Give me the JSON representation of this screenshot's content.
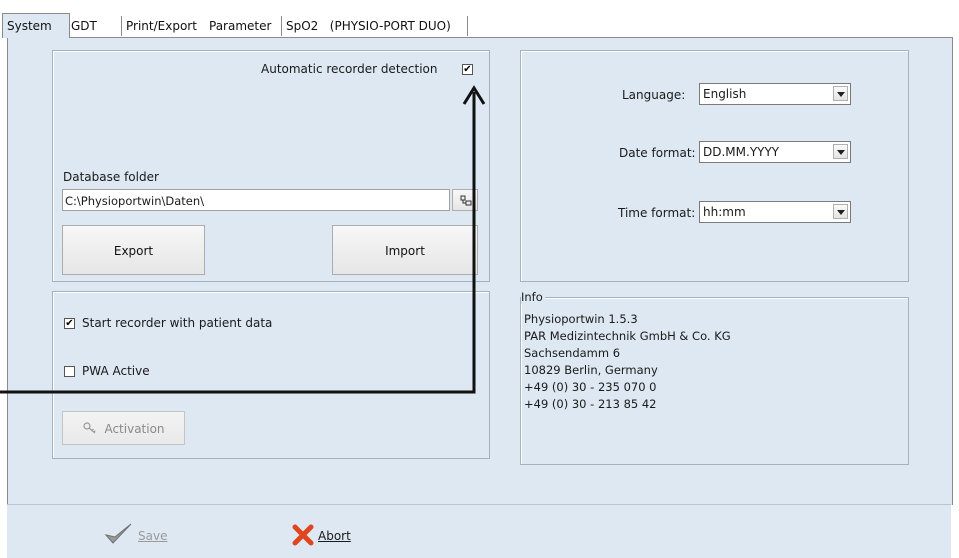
{
  "tabs": [
    "System",
    "GDT",
    "Print/Export",
    "Parameter",
    "SpO2",
    "(PHYSIO-PORT DUO)"
  ],
  "database": {
    "auto_detect_label": "Automatic recorder detection",
    "auto_detect_checked": true,
    "folder_label": "Database folder",
    "folder_value": "C:\\Physioportwin\\Daten\\",
    "export_label": "Export",
    "import_label": "Import"
  },
  "options": {
    "start_recorder_label": "Start recorder with patient data",
    "start_recorder_checked": true,
    "pwa_label": "PWA Active",
    "pwa_checked": false,
    "activation_label": "Activation"
  },
  "regional": {
    "language_label": "Language:",
    "language_value": "English",
    "date_format_label": "Date format:",
    "date_format_value": "DD.MM.YYYY",
    "time_format_label": "Time format:",
    "time_format_value": "hh:mm"
  },
  "info": {
    "title": "Info",
    "lines": [
      "Physioportwin 1.5.3",
      "PAR Medizintechnik GmbH & Co. KG",
      "Sachsendamm 6",
      "10829 Berlin, Germany",
      "+49 (0) 30 - 235 070 0",
      "+49 (0) 30 - 213 85 42"
    ]
  },
  "footer": {
    "save_label": "Save",
    "abort_label": "Abort"
  },
  "colors": {
    "panel_bg": "#dde8f2",
    "annotation_arrow": "#111111",
    "abort_icon": "#e0461d"
  },
  "icons": {
    "folder_browse": "folder-browse-icon",
    "activation": "key-icon",
    "save": "checkmark-icon",
    "abort": "x-icon"
  }
}
